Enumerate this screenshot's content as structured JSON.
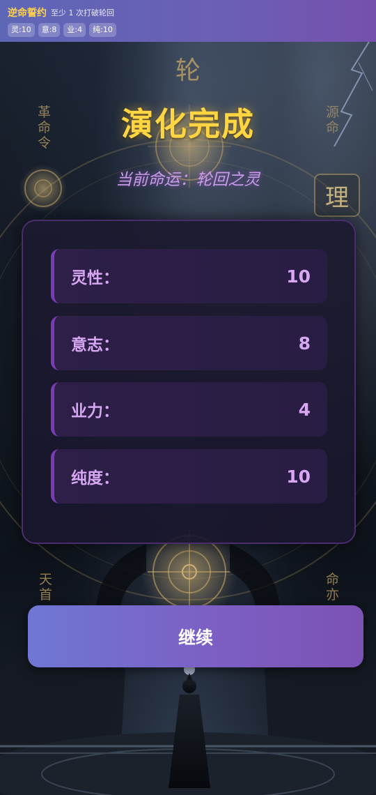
{
  "topbar": {
    "title": "逆命誓约",
    "subtitle": "至少 1 次打破轮回",
    "chips": [
      "灵:10",
      "意:8",
      "业:4",
      "纯:10"
    ]
  },
  "background": {
    "glyphs": {
      "top": "轮",
      "left_column": "革命令",
      "right_column": "源命",
      "right_seal": "理",
      "bottom_left": "天首",
      "bottom_right": "命亦"
    }
  },
  "heading": "演化完成",
  "subheading": "当前命运：轮回之灵",
  "stats": [
    {
      "label": "灵性：",
      "value": "10"
    },
    {
      "label": "意志：",
      "value": "8"
    },
    {
      "label": "业力：",
      "value": "4"
    },
    {
      "label": "纯度：",
      "value": "10"
    }
  ],
  "continue_label": "继续",
  "colors": {
    "accent_gold": "#ffd541",
    "accent_purple": "#7a3cb6",
    "stat_text": "#d7a7f4",
    "button_start": "#6f77d4",
    "button_end": "#7c52b4"
  }
}
